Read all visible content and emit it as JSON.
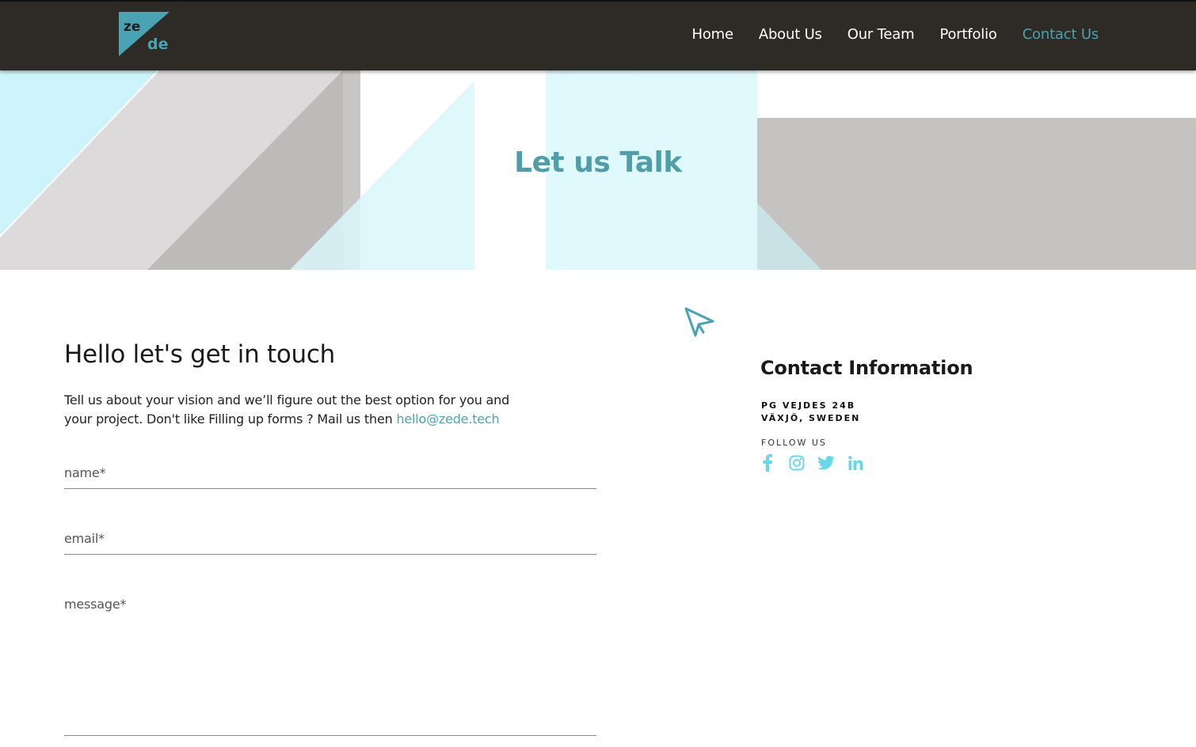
{
  "header": {
    "logo": {
      "top_text": "ze",
      "bottom_text": "de",
      "color": "#4aa3b2"
    },
    "nav": [
      {
        "label": "Home"
      },
      {
        "label": "About Us"
      },
      {
        "label": "Our Team"
      },
      {
        "label": "Portfolio"
      },
      {
        "label": "Contact Us",
        "active": true
      }
    ]
  },
  "hero": {
    "title": "Let us Talk"
  },
  "form": {
    "heading": "Hello let's get in touch",
    "intro": "Tell us about your vision and we’ll figure out the best option for you and your project. Don't like Filling up forms ? Mail us then ",
    "email_link": "hello@zede.tech",
    "fields": {
      "name": "name*",
      "email": "email*",
      "message": "message*"
    }
  },
  "contact": {
    "title": "Contact Information",
    "address_line1": "PG VEJDES 24B",
    "address_line2": "VÄXJÖ, SWEDEN",
    "follow_label": "FOLLOW US",
    "socials": [
      "facebook-icon",
      "instagram-icon",
      "twitter-icon",
      "linkedin-icon"
    ]
  },
  "colors": {
    "header_bg": "#2e2a25",
    "accent": "#4aa3b2",
    "social": "#6ad6ea"
  }
}
